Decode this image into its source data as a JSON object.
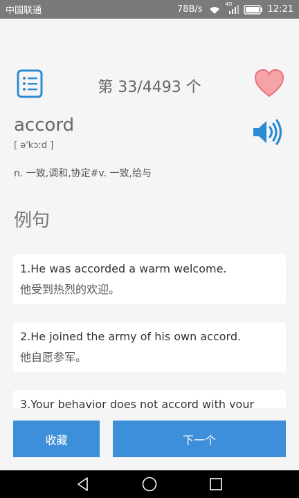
{
  "status": {
    "carrier": "中国联通",
    "speed": "78B/s",
    "network": "4G",
    "time": "12:21"
  },
  "header": {
    "counter": "第 33/4493 个"
  },
  "word": {
    "text": "accord",
    "phonetic": "[ ə'kɔːd ]",
    "meaning": "n. 一致,调和,协定#v. 一致,给与"
  },
  "section": {
    "title": "例句"
  },
  "examples": [
    {
      "en": "1.He was accorded a warm welcome.",
      "zh": "他受到热烈的欢迎。"
    },
    {
      "en": "2.He joined the army of his own accord.",
      "zh": "他自愿参军。"
    },
    {
      "en": "3.Your behavior does not accord with your",
      "zh": ""
    }
  ],
  "buttons": {
    "favorite": "收藏",
    "next": "下一个"
  },
  "colors": {
    "accent": "#3d8fd9",
    "heart": "#f5a3a6",
    "heart_stroke": "#e8717a",
    "statusbar": "#7a7a7a"
  }
}
